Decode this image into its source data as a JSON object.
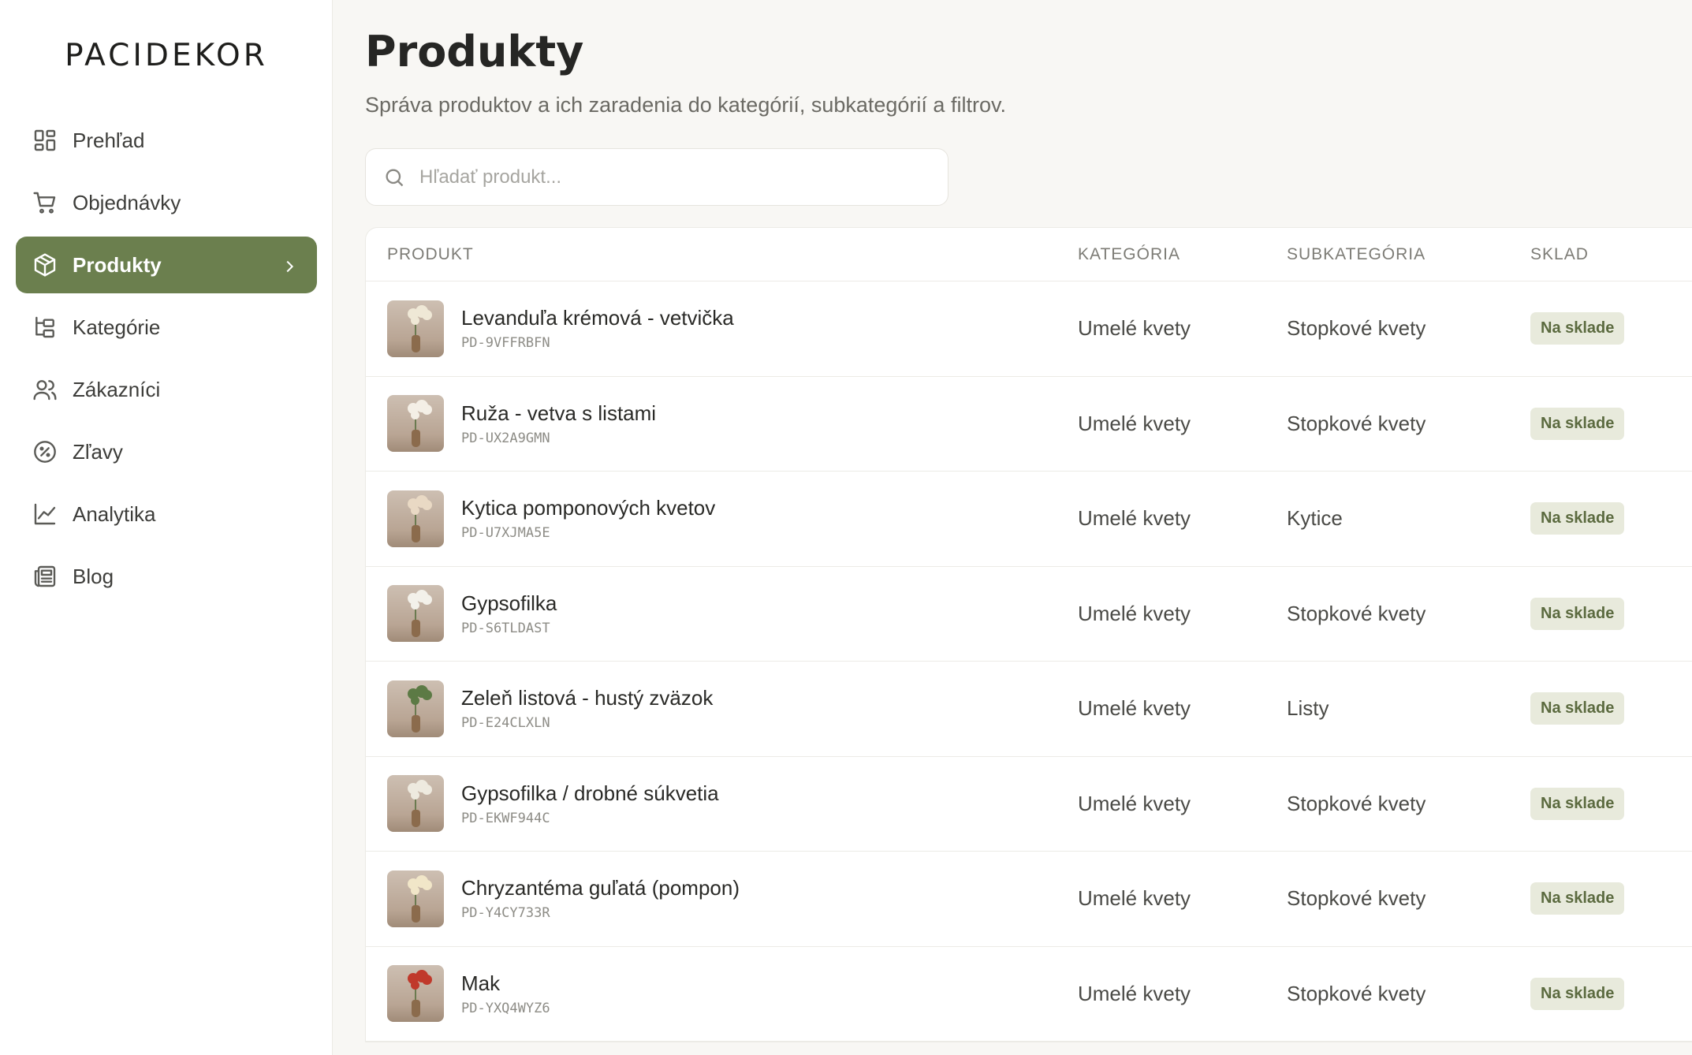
{
  "brand": "PACIDEKOR",
  "sidebar": {
    "items": [
      {
        "label": "Prehľad",
        "icon": "dashboard-icon"
      },
      {
        "label": "Objednávky",
        "icon": "cart-icon"
      },
      {
        "label": "Produkty",
        "icon": "box-icon",
        "active": true
      },
      {
        "label": "Kategórie",
        "icon": "category-tree-icon"
      },
      {
        "label": "Zákazníci",
        "icon": "users-icon"
      },
      {
        "label": "Zľavy",
        "icon": "discount-icon"
      },
      {
        "label": "Analytika",
        "icon": "chart-line-icon"
      },
      {
        "label": "Blog",
        "icon": "newspaper-icon"
      }
    ]
  },
  "page": {
    "title": "Produkty",
    "subtitle": "Správa produktov a ich zaradenia do kategórií, subkategórií a filtrov."
  },
  "search": {
    "placeholder": "Hľadať produkt..."
  },
  "table": {
    "headers": {
      "product": "PRODUKT",
      "category": "KATEGÓRIA",
      "subcategory": "SUBKATEGÓRIA",
      "stock": "SKLAD"
    },
    "rows": [
      {
        "name": "Levanduľa krémová - vetvička",
        "sku": "PD-9VFFRBFN",
        "category": "Umelé kvety",
        "subcategory": "Stopkové kvety",
        "stock": "Na sklade"
      },
      {
        "name": "Ruža - vetva s listami",
        "sku": "PD-UX2A9GMN",
        "category": "Umelé kvety",
        "subcategory": "Stopkové kvety",
        "stock": "Na sklade"
      },
      {
        "name": "Kytica pomponových kvetov",
        "sku": "PD-U7XJMA5E",
        "category": "Umelé kvety",
        "subcategory": "Kytice",
        "stock": "Na sklade"
      },
      {
        "name": "Gypsofilka",
        "sku": "PD-S6TLDAST",
        "category": "Umelé kvety",
        "subcategory": "Stopkové kvety",
        "stock": "Na sklade"
      },
      {
        "name": "Zeleň listová - hustý zväzok",
        "sku": "PD-E24CLXLN",
        "category": "Umelé kvety",
        "subcategory": "Listy",
        "stock": "Na sklade"
      },
      {
        "name": "Gypsofilka / drobné súkvetia",
        "sku": "PD-EKWF944C",
        "category": "Umelé kvety",
        "subcategory": "Stopkové kvety",
        "stock": "Na sklade"
      },
      {
        "name": "Chryzantéma guľatá (pompon)",
        "sku": "PD-Y4CY733R",
        "category": "Umelé kvety",
        "subcategory": "Stopkové kvety",
        "stock": "Na sklade"
      },
      {
        "name": "Mak",
        "sku": "PD-YXQ4WYZ6",
        "category": "Umelé kvety",
        "subcategory": "Stopkové kvety",
        "stock": "Na sklade"
      }
    ]
  },
  "colors": {
    "accent": "#6b7f4e",
    "badge_bg": "#e8eadc",
    "badge_text": "#5b6a3f",
    "background": "#f8f7f4"
  }
}
